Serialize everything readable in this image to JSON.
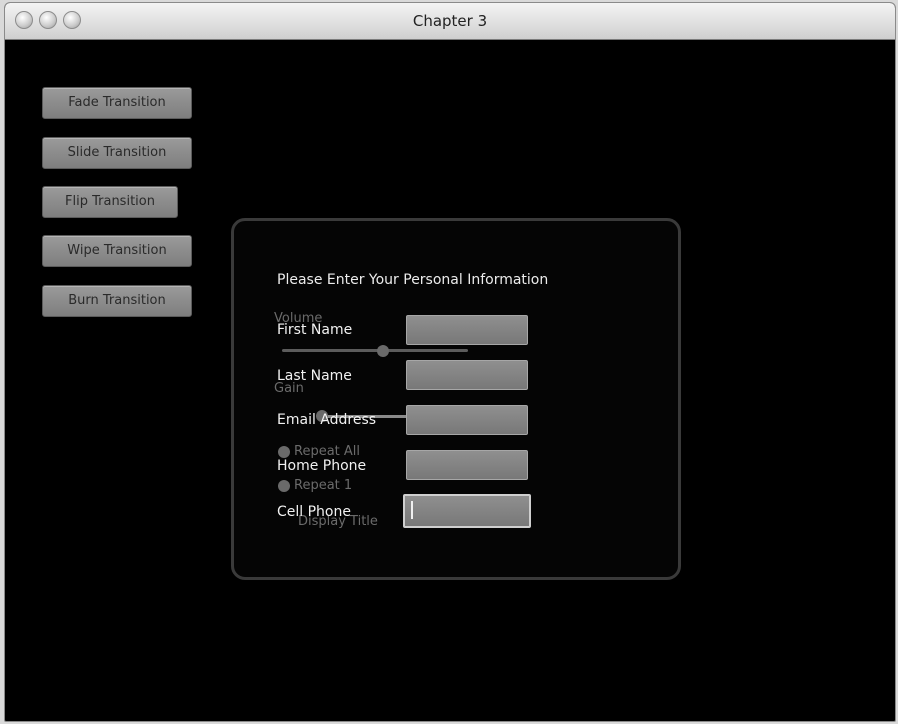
{
  "window": {
    "title": "Chapter 3"
  },
  "transitions": [
    {
      "label": "Fade Transition"
    },
    {
      "label": "Slide Transition"
    },
    {
      "label": "Flip Transition"
    },
    {
      "label": "Wipe Transition"
    },
    {
      "label": "Burn Transition"
    }
  ],
  "form": {
    "heading": "Please Enter Your Personal Information",
    "fields": [
      {
        "label": "First Name",
        "value": ""
      },
      {
        "label": "Last Name",
        "value": ""
      },
      {
        "label": "Email Address",
        "value": ""
      },
      {
        "label": "Home Phone",
        "value": ""
      },
      {
        "label": "Cell Phone",
        "value": ""
      }
    ]
  },
  "ghost_panel": {
    "volume_label": "Volume",
    "gain_label": "Gain",
    "repeat_all": "Repeat All",
    "repeat_one": "Repeat 1",
    "display_title": "Display Title"
  }
}
